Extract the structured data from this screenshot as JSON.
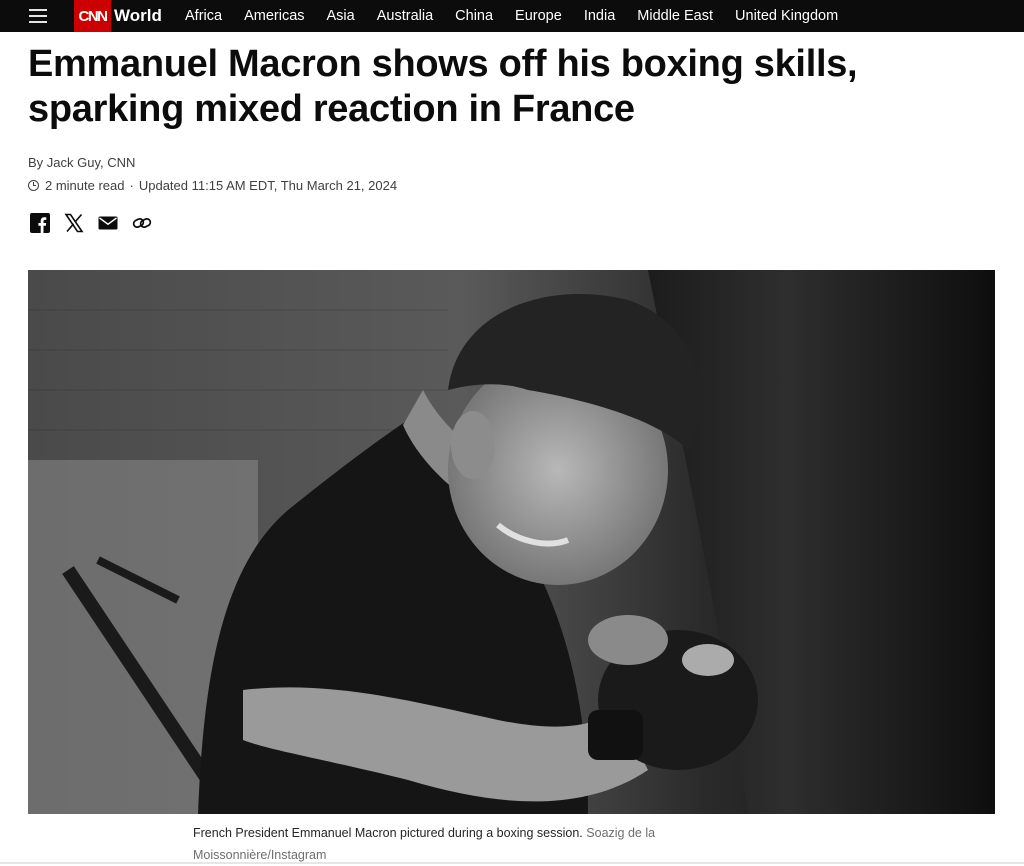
{
  "nav": {
    "section": "World",
    "logo": "CNN",
    "links": [
      "Africa",
      "Americas",
      "Asia",
      "Australia",
      "China",
      "Europe",
      "India",
      "Middle East",
      "United Kingdom"
    ]
  },
  "article": {
    "headline": "Emmanuel Macron shows off his boxing skills, sparking mixed reaction in France",
    "byline": "By Jack Guy, CNN",
    "read_time": "2 minute read",
    "updated": "Updated 11:15 AM EDT, Thu March 21, 2024",
    "share_icons": [
      "facebook-icon",
      "x-icon",
      "email-icon",
      "link-icon"
    ]
  },
  "image": {
    "caption": "French President Emmanuel Macron pictured during a boxing session.",
    "credit": "Soazig de la Moissonnière/Instagram"
  },
  "colors": {
    "nav_bg": "#0c0c0c",
    "brand_red": "#cc0000",
    "text": "#0c0c0c",
    "meta_text": "#404040",
    "credit_text": "#6e6e6e"
  }
}
